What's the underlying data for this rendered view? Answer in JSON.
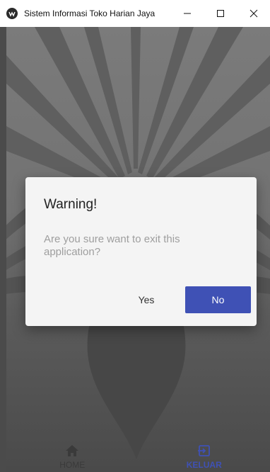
{
  "window": {
    "title": "Sistem Informasi Toko Harian Jaya",
    "controls": {
      "minimize_icon": "minimize-icon",
      "maximize_icon": "maximize-icon",
      "close_icon": "close-icon"
    }
  },
  "dialog": {
    "title": "Warning!",
    "message": "Are you sure want to exit this application?",
    "yes_label": "Yes",
    "no_label": "No"
  },
  "bottom_nav": {
    "items": [
      {
        "label": "HOME",
        "icon": "home-icon",
        "active": false
      },
      {
        "label": "KELUAR",
        "icon": "exit-icon",
        "active": true
      }
    ]
  },
  "colors": {
    "accent": "#3f51b5",
    "dialog_bg": "#f4f4f4",
    "overlay": "#5a5a5a"
  }
}
